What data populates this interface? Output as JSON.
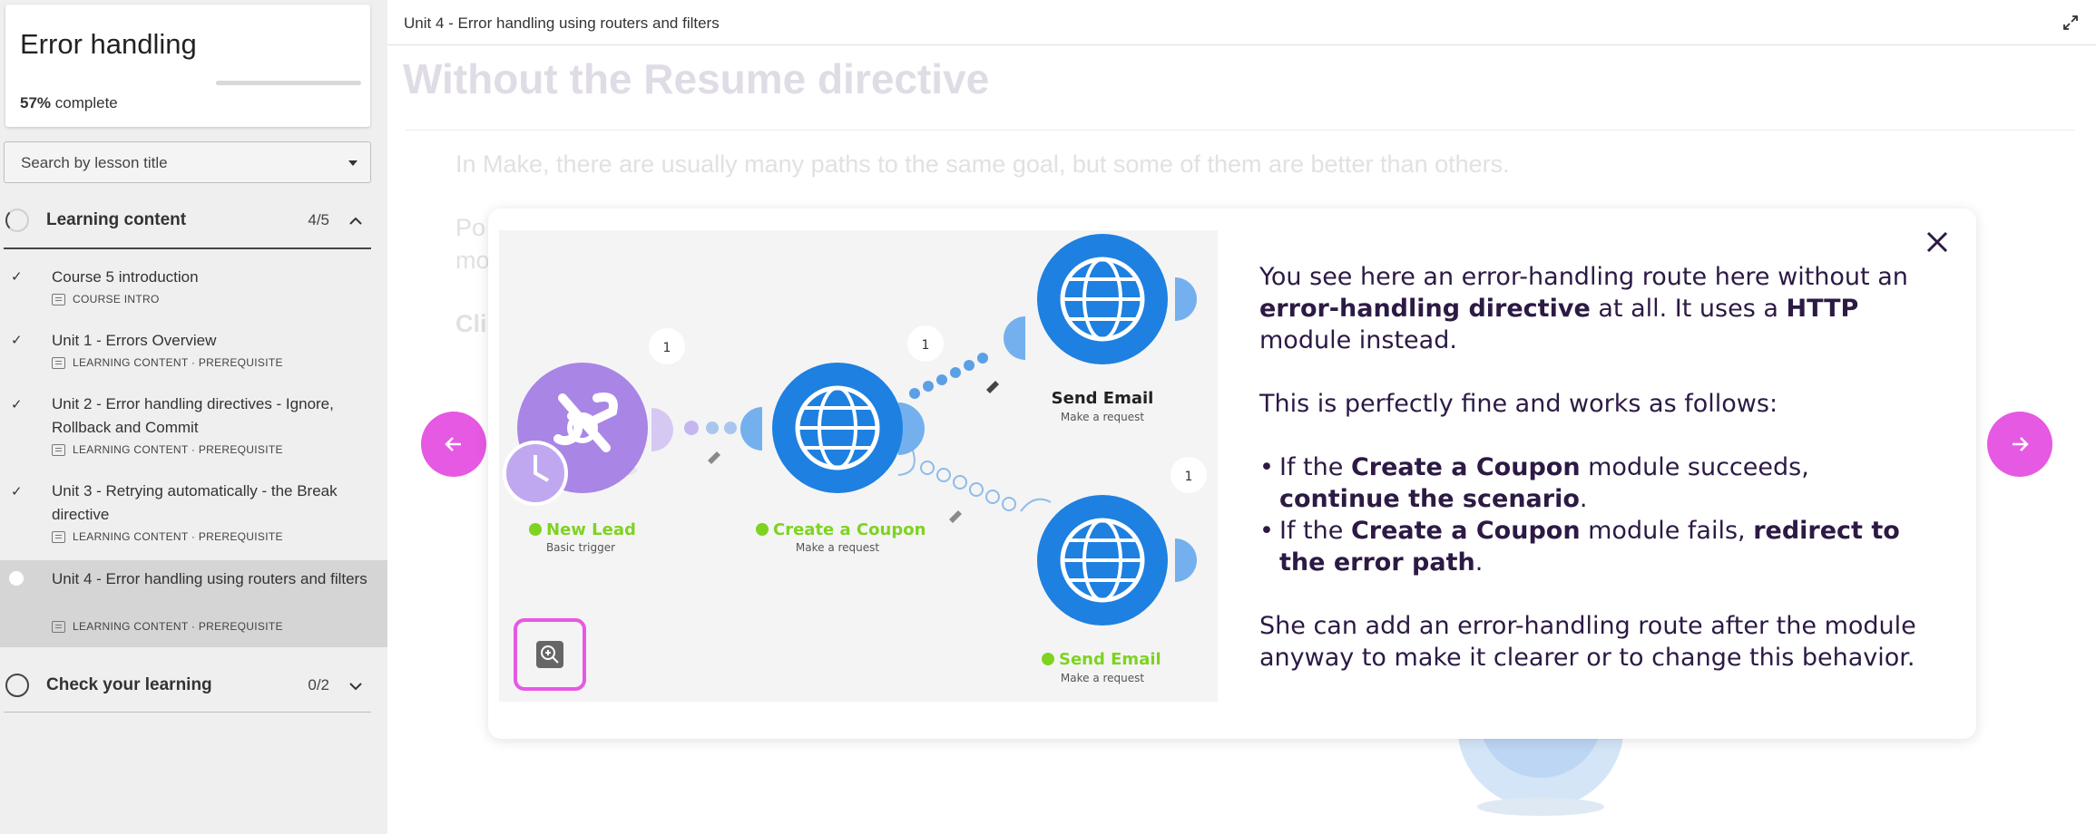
{
  "sidebar": {
    "course_title": "Error handling",
    "progress_percent": "57%",
    "progress_suffix": "complete",
    "progress_fraction": 0.57,
    "search_placeholder": "Search by lesson title",
    "sections": [
      {
        "title": "Learning content",
        "count": "4/5",
        "expanded": true
      },
      {
        "title": "Check your learning",
        "count": "0/2",
        "expanded": false
      }
    ],
    "lessons": [
      {
        "title": "Course 5 introduction",
        "meta": "COURSE INTRO",
        "done": true
      },
      {
        "title": "Unit 1 - Errors Overview",
        "meta": "LEARNING CONTENT · PREREQUISITE",
        "done": true
      },
      {
        "title": "Unit 2 - Error handling directives - Ignore, Rollback and Commit",
        "meta": "LEARNING CONTENT · PREREQUISITE",
        "done": true
      },
      {
        "title": "Unit 3 - Retrying automatically - the Break directive",
        "meta": "LEARNING CONTENT · PREREQUISITE",
        "done": true
      },
      {
        "title": "Unit 4 - Error handling using routers and filters",
        "meta": "LEARNING CONTENT · PREREQUISITE",
        "done": false,
        "active": true
      }
    ]
  },
  "main": {
    "breadcrumb": "Unit 4 - Error handling using routers and filters",
    "bg_heading": "Without the Resume directive",
    "bg_paragraph": "In Make, there are usually many paths to the same goal, but some of them are better than others.",
    "bg_fragments": [
      "Po",
      "mo",
      "Cli"
    ]
  },
  "modal": {
    "diagram": {
      "nodes": [
        {
          "label": "New Lead",
          "sub": "Basic trigger",
          "badge": "1"
        },
        {
          "label": "Create a Coupon",
          "sub": "Make a request",
          "badge": "1"
        },
        {
          "label": "Send Email",
          "sub": "Make a request"
        },
        {
          "label": "Send Email",
          "sub": "Make a request",
          "badge": "1"
        }
      ]
    },
    "text": {
      "p1_a": "You see here an error-handling route here without an ",
      "p1_b": "error-handling directive",
      "p1_c": " at all. It uses a ",
      "p1_d": "HTTP",
      "p1_e": " module instead.",
      "p2": "This is perfectly fine and works as follows:",
      "li1_a": "If the ",
      "li1_b": "Create a Coupon",
      "li1_c": " module succeeds, ",
      "li1_d": "continue the scenario",
      "li1_e": ".",
      "li2_a": "If the ",
      "li2_b": "Create a Coupon",
      "li2_c": " module fails, ",
      "li2_d": "redirect to the error path",
      "li2_e": ".",
      "p3": "She can add an error-handling route after the module anyway to make it clearer or to change this behavior."
    }
  },
  "colors": {
    "accent": "#e659e3",
    "globe_blue": "#1e80e0",
    "trigger_purple": "#a985e6",
    "success_green": "#7ed321",
    "text_dark": "#2c1a44"
  },
  "icons": {
    "close": "close-icon",
    "prev": "arrow-left-icon",
    "next": "arrow-right-icon",
    "expand": "expand-icon",
    "zoom": "zoom-in-icon"
  }
}
